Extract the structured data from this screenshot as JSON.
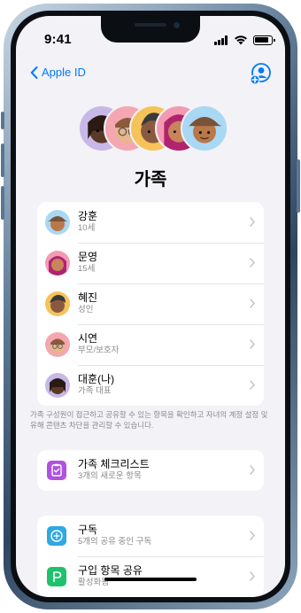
{
  "status_bar": {
    "time": "9:41"
  },
  "nav": {
    "back_label": "Apple ID"
  },
  "page_title": "가족",
  "members": [
    {
      "name": "강훈",
      "sub": "10세"
    },
    {
      "name": "문영",
      "sub": "15세"
    },
    {
      "name": "혜진",
      "sub": "성인"
    },
    {
      "name": "시연",
      "sub": "부모/보호자"
    },
    {
      "name": "대훈(나)",
      "sub": "가족 대표"
    }
  ],
  "members_footer": "가족 구성원이 접근하고 공유할 수 있는 항목을 확인하고 자녀의 계정 설정 및 유해 콘텐츠 차단을 관리할 수 있습니다.",
  "checklist": {
    "title": "가족 체크리스트",
    "sub": "3개의 새로운 항목"
  },
  "sharing": [
    {
      "title": "구독",
      "sub": "5개의 공유 중인 구독"
    },
    {
      "title": "구입 항목 공유",
      "sub": "활성화됨"
    }
  ],
  "colors": {
    "accent": "#007aff",
    "checklist_icon": "#af52de",
    "subscription_icon": "#30a8e0",
    "purchase_icon": "#1ec26c"
  }
}
